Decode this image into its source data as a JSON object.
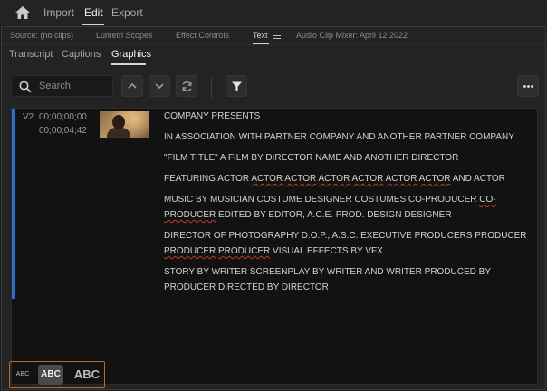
{
  "topbar": {
    "home_icon": "home-icon",
    "menu": [
      {
        "label": "Import"
      },
      {
        "label": "Edit"
      },
      {
        "label": "Export"
      }
    ],
    "active_menu": "Edit"
  },
  "panel_tabs": [
    {
      "label": "Source: (no clips)"
    },
    {
      "label": "Lumetri Scopes"
    },
    {
      "label": "Effect Controls"
    },
    {
      "label": "Text"
    },
    {
      "label": "Audio Clip Mixer: April 12 2022"
    }
  ],
  "active_panel_tab": "Text",
  "subtabs": [
    {
      "label": "Transcript"
    },
    {
      "label": "Captions"
    },
    {
      "label": "Graphics"
    }
  ],
  "active_subtab": "Graphics",
  "toolbar": {
    "search_placeholder": "Search",
    "icons": [
      "search-icon",
      "chevron-up-icon",
      "chevron-down-icon",
      "refresh-icon",
      "filter-icon",
      "more-icon"
    ]
  },
  "graphic_item": {
    "track": "V2",
    "timecode_in": "00;00;00;00",
    "timecode_out": "00;00;04;42",
    "lines": [
      "COMPANY PRESENTS",
      "IN ASSOCIATION WITH PARTNER COMPANY AND ANOTHER PARTNER COMPANY",
      "\"FILM TITLE\" A FILM BY DIRECTOR NAME AND ANOTHER DIRECTOR",
      "FEATURING ACTOR ACTOR ACTOR ACTOR ACTOR ACTOR ACTOR AND ACTOR",
      "MUSIC BY MUSICIAN COSTUME DESIGNER COSTUMES CO-PRODUCER CO-PRODUCER EDITED BY EDITOR, A.C.E. PROD. DESIGN DESIGNER",
      "DIRECTOR OF PHOTOGRAPHY D.O.P., A.S.C. EXECUTIVE PRODUCERS PRODUCER PRODUCER PRODUCER VISUAL EFFECTS BY VFX",
      "STORY BY WRITER SCREENPLAY BY WRITER AND WRITER PRODUCED BY PRODUCER DIRECTED BY DIRECTOR"
    ]
  },
  "text_size": {
    "options": [
      {
        "label": "ABC"
      },
      {
        "label": "ABC"
      },
      {
        "label": "ABC"
      }
    ],
    "selected": 1
  },
  "colors": {
    "accent": "#2d6fc7",
    "size_outline": "#c06a21",
    "spellcheck": "#c0392b"
  }
}
